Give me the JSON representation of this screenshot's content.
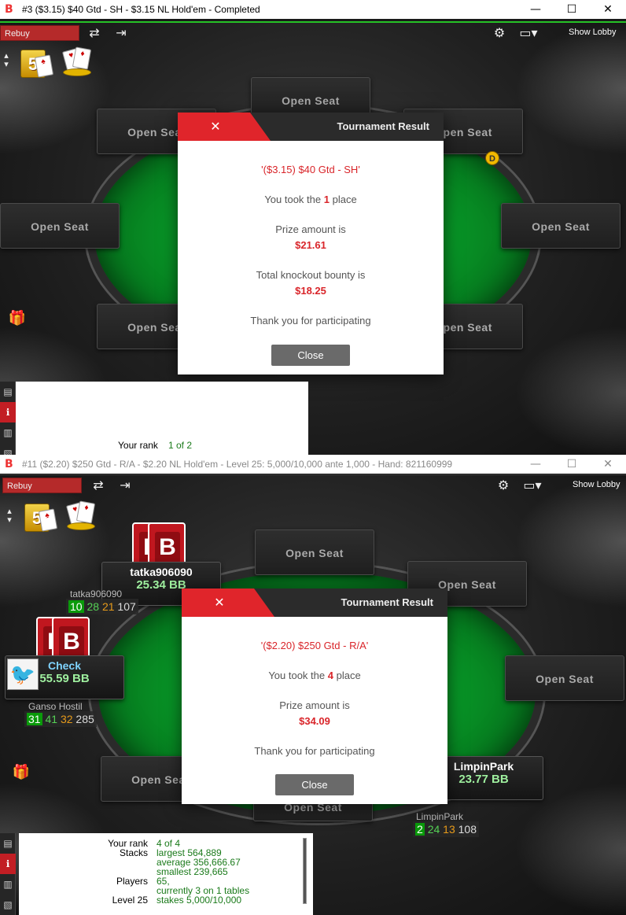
{
  "window1": {
    "title": "#3 ($3.15) $40 Gtd - SH - $3.15 NL Hold'em - Completed",
    "rebuy": "Rebuy",
    "show_lobby": "Show Lobby",
    "seats": [
      "Open Seat",
      "Open Seat",
      "Open Seat",
      "Open Seat",
      "Open Seat",
      "Open Seat",
      "Open Seat",
      "Open Seat"
    ],
    "dealer": "D",
    "modal": {
      "title": "Tournament Result",
      "tournament": "'($3.15) $40 Gtd - SH'",
      "took_prefix": "You took the",
      "place": "1",
      "took_suffix": "place",
      "prize_label": "Prize amount is",
      "prize": "$21.61",
      "bounty_label": "Total knockout bounty is",
      "bounty": "$18.25",
      "thanks": "Thank you for participating",
      "close": "Close"
    },
    "info": {
      "rank_label": "Your rank",
      "rank_value": "1 of 2"
    }
  },
  "window2": {
    "title": "#11 ($2.20) $250 Gtd - R/A - $2.20 NL Hold'em - Level 25: 5,000/10,000 ante 1,000 - Hand: 821160999",
    "rebuy": "Rebuy",
    "show_lobby": "Show Lobby",
    "seats": [
      "Open Seat",
      "Open Seat",
      "Open Seat",
      "Open Seat",
      "Open Seat"
    ],
    "players": [
      {
        "name": "tatka906090",
        "stack": "25.34 BB",
        "hud_name": "tatka906090",
        "hud": [
          "10",
          "28",
          "21",
          "107"
        ]
      },
      {
        "name": "Check",
        "stack": "55.59 BB",
        "hud_name": "Ganso Hostil",
        "hud": [
          "31",
          "41",
          "32",
          "285"
        ]
      },
      {
        "name": "LimpinPark",
        "stack": "23.77 BB",
        "hud_name": "LimpinPark",
        "hud": [
          "2",
          "24",
          "13",
          "108"
        ]
      }
    ],
    "modal": {
      "title": "Tournament Result",
      "tournament": "'($2.20) $250 Gtd - R/A'",
      "took_prefix": "You took the",
      "place": "4",
      "took_suffix": "place",
      "prize_label": "Prize amount is",
      "prize": "$34.09",
      "thanks": "Thank you for participating",
      "close": "Close"
    },
    "info": {
      "rank_label": "Your rank",
      "rank_value": "4 of 4",
      "stacks_label": "Stacks",
      "stacks_largest": "largest 564,889",
      "stacks_average": "average 356,666.67",
      "stacks_smallest": "smallest 239,665",
      "players_label": "Players",
      "players_value": "65,",
      "players_tables": "currently 3 on 1 tables",
      "level_label": "Level 25",
      "level_value": "stakes 5,000/10,000"
    }
  },
  "icons": {
    "brand": "B",
    "minimize": "—",
    "maximize": "☐",
    "close": "✕"
  }
}
